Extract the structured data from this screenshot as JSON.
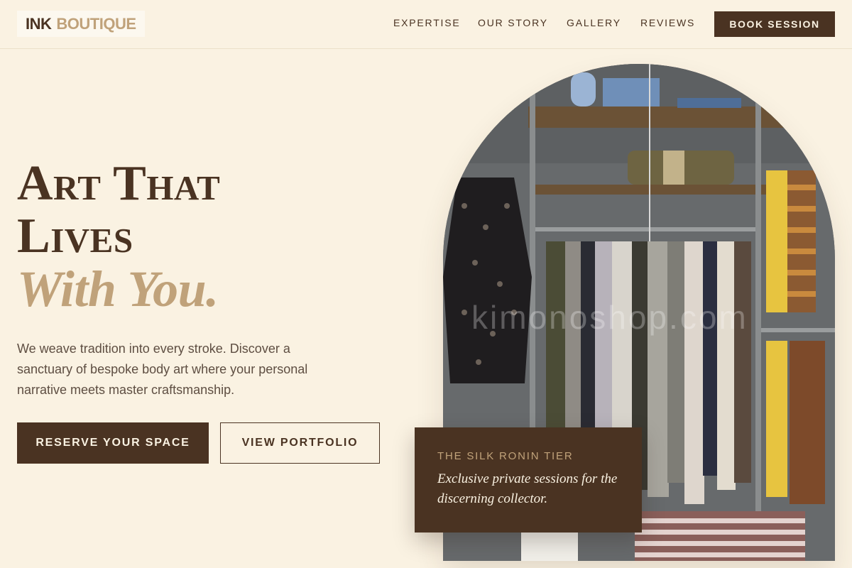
{
  "brand": {
    "part1": "INK",
    "part2": "BOUTIQUE"
  },
  "nav": {
    "items": [
      {
        "label": "EXPERTISE"
      },
      {
        "label": "OUR STORY"
      },
      {
        "label": "GALLERY"
      },
      {
        "label": "REVIEWS"
      }
    ],
    "cta_label": "BOOK SESSION"
  },
  "hero": {
    "headline_line1": "Art That",
    "headline_line2": "Lives",
    "headline_line3": "With You.",
    "lede": "We weave tradition into every stroke. Discover a sanctuary of bespoke body art where your personal narrative meets master craftsmanship.",
    "primary_button": "RESERVE YOUR SPACE",
    "secondary_button": "VIEW PORTFOLIO"
  },
  "image": {
    "watermark": "kimonoshop.com"
  },
  "tier_card": {
    "label": "THE SILK RONIN TIER",
    "description": "Exclusive private sessions for the discerning collector."
  },
  "colors": {
    "background": "#faf2e2",
    "primary": "#4a3322",
    "accent": "#c0a27a"
  }
}
